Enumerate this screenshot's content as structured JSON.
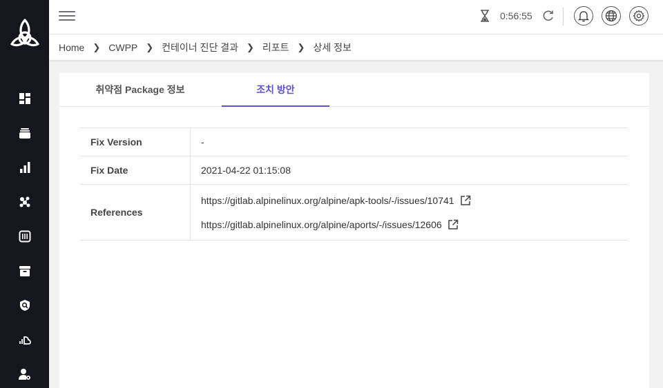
{
  "header": {
    "session_timer": "0:56:55",
    "icons": [
      "menu-icon",
      "hourglass-icon",
      "refresh-icon",
      "bell-icon",
      "globe-icon",
      "gear-icon"
    ]
  },
  "sidebar": {
    "logo": "triquetra-logo",
    "items": [
      {
        "icon": "dashboard-icon"
      },
      {
        "icon": "layers-icon"
      },
      {
        "icon": "bar-chart-icon"
      },
      {
        "icon": "network-icon"
      },
      {
        "icon": "registry-icon"
      },
      {
        "icon": "archive-icon"
      },
      {
        "icon": "shield-search-icon"
      },
      {
        "icon": "cloud-icon"
      },
      {
        "icon": "user-settings-icon"
      }
    ]
  },
  "breadcrumb": [
    "Home",
    "CWPP",
    "컨테이너 진단 결과",
    "리포트",
    "상세 정보"
  ],
  "tabs": [
    {
      "label": "취약점 Package 정보",
      "active": false
    },
    {
      "label": "조치 방안",
      "active": true
    }
  ],
  "details": {
    "fix_version_label": "Fix Version",
    "fix_version": "-",
    "fix_date_label": "Fix Date",
    "fix_date": "2021-04-22 01:15:08",
    "references_label": "References",
    "references": [
      "https://gitlab.alpinelinux.org/alpine/apk-tools/-/issues/10741",
      "https://gitlab.alpinelinux.org/alpine/aports/-/issues/12606"
    ]
  },
  "colors": {
    "sidebar_bg": "#15161e",
    "accent": "#5b4fd6",
    "page_bg": "#f2f2f3"
  }
}
